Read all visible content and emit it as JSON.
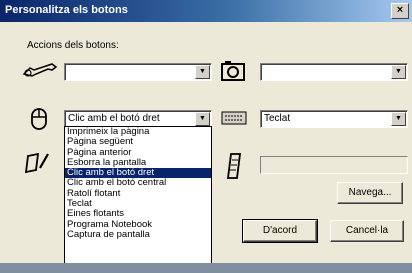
{
  "window": {
    "title": "Personalitza els botons",
    "close_label": "×"
  },
  "section_label": "Accions dels botons:",
  "rows": {
    "row1_left_value": "",
    "row1_right_value": "",
    "row2_left_value": "Clic amb el botó dret",
    "row2_right_value": "Teclat",
    "row3_right_value": ""
  },
  "dropdown": {
    "items": [
      "Imprimeix la pàgina",
      "Pàgina següent",
      "Pàgina anterior",
      "Esborra la pantalla",
      "Clic amb el botó dret",
      "Clic amb el botó central",
      "Ratolí flotant",
      "Teclat",
      "Eines flotants",
      "Programa Notebook",
      "Captura de pantalla"
    ],
    "selected_index": 4
  },
  "buttons": {
    "browse": "Navega...",
    "ok": "D'acord",
    "cancel": "Cancel·la"
  },
  "icons": {
    "wrench": "wrench-icon",
    "camera": "camera-icon",
    "mouse": "mouse-icon",
    "keyboard": "keyboard-icon",
    "pen": "pen-icon",
    "device": "device-icon"
  }
}
